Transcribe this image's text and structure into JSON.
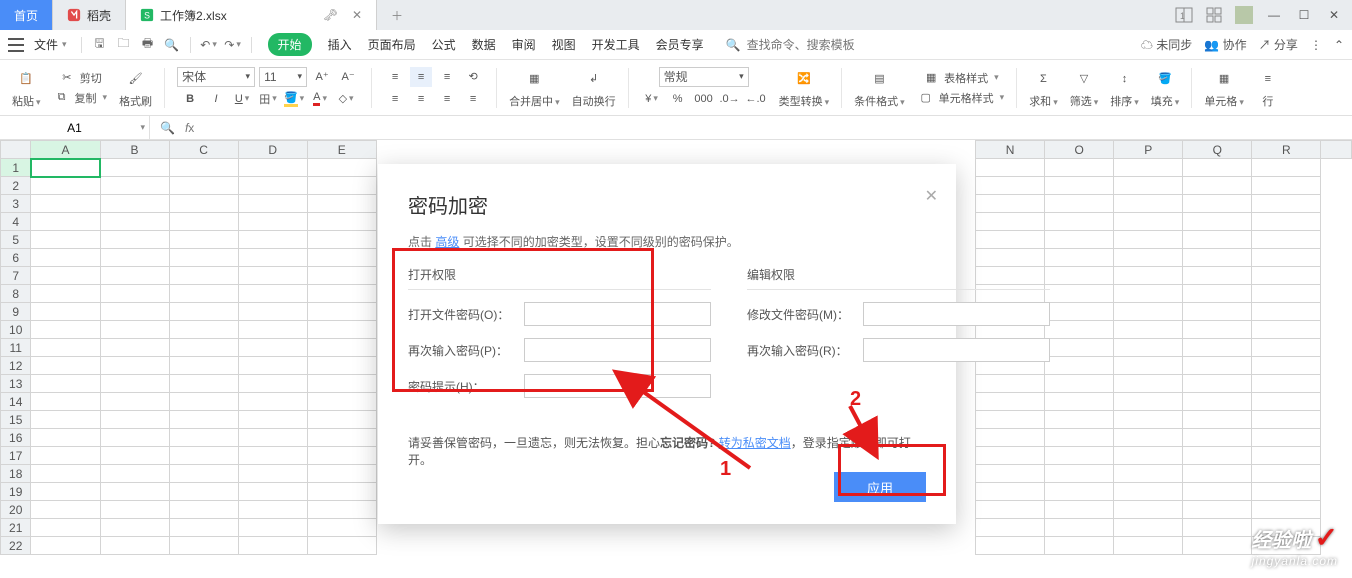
{
  "tabs": {
    "home": "首页",
    "shell": "稻壳",
    "file": "工作簿2.xlsx"
  },
  "menubar": {
    "file": "文件",
    "items": [
      "开始",
      "插入",
      "页面布局",
      "公式",
      "数据",
      "审阅",
      "视图",
      "开发工具",
      "会员专享"
    ],
    "search_placeholder": "查找命令、搜索模板",
    "unsync": "未同步",
    "coop": "协作",
    "share": "分享"
  },
  "ribbon": {
    "paste": "粘贴",
    "cut": "剪切",
    "copy": "复制",
    "format_painter": "格式刷",
    "font_name": "宋体",
    "font_size": "11",
    "merge": "合并居中",
    "wrap": "自动换行",
    "numfmt": "常规",
    "type_convert": "类型转换",
    "cond_fmt": "条件格式",
    "table_style": "表格样式",
    "cell_style": "单元格样式",
    "sum": "求和",
    "filter": "筛选",
    "sort": "排序",
    "fill": "填充",
    "cells": "单元格",
    "rows": "行"
  },
  "namebox": {
    "value": "A1"
  },
  "grid": {
    "cols": [
      "A",
      "B",
      "C",
      "D",
      "E",
      "N",
      "O",
      "P",
      "Q",
      "R"
    ],
    "leftCols": [
      "A",
      "B",
      "C",
      "D",
      "E"
    ],
    "rightCols": [
      "N",
      "O",
      "P",
      "Q",
      "R"
    ],
    "rows": 22
  },
  "dialog": {
    "title": "密码加密",
    "hint_pre": "点击 ",
    "hint_link": "高级",
    "hint_post": " 可选择不同的加密类型，设置不同级别的密码保护。",
    "open_perm": "打开权限",
    "edit_perm": "编辑权限",
    "open_pwd": "打开文件密码(O)：",
    "open_pwd2": "再次输入密码(P)：",
    "hint_label": "密码提示(H)：",
    "edit_pwd": "修改文件密码(M)：",
    "edit_pwd2": "再次输入密码(R)：",
    "bottom1": "请妥善保管密码，一旦遗忘，则无法恢复。担心",
    "bottom_bold": "忘记密码?",
    "bottom_link": "转为私密文档",
    "bottom2": "，登录指定账号即可打开。",
    "apply": "应用"
  },
  "ann": {
    "one": "1",
    "two": "2"
  },
  "watermark": {
    "l1": "经验啦",
    "l2": "jingyanla.com"
  }
}
